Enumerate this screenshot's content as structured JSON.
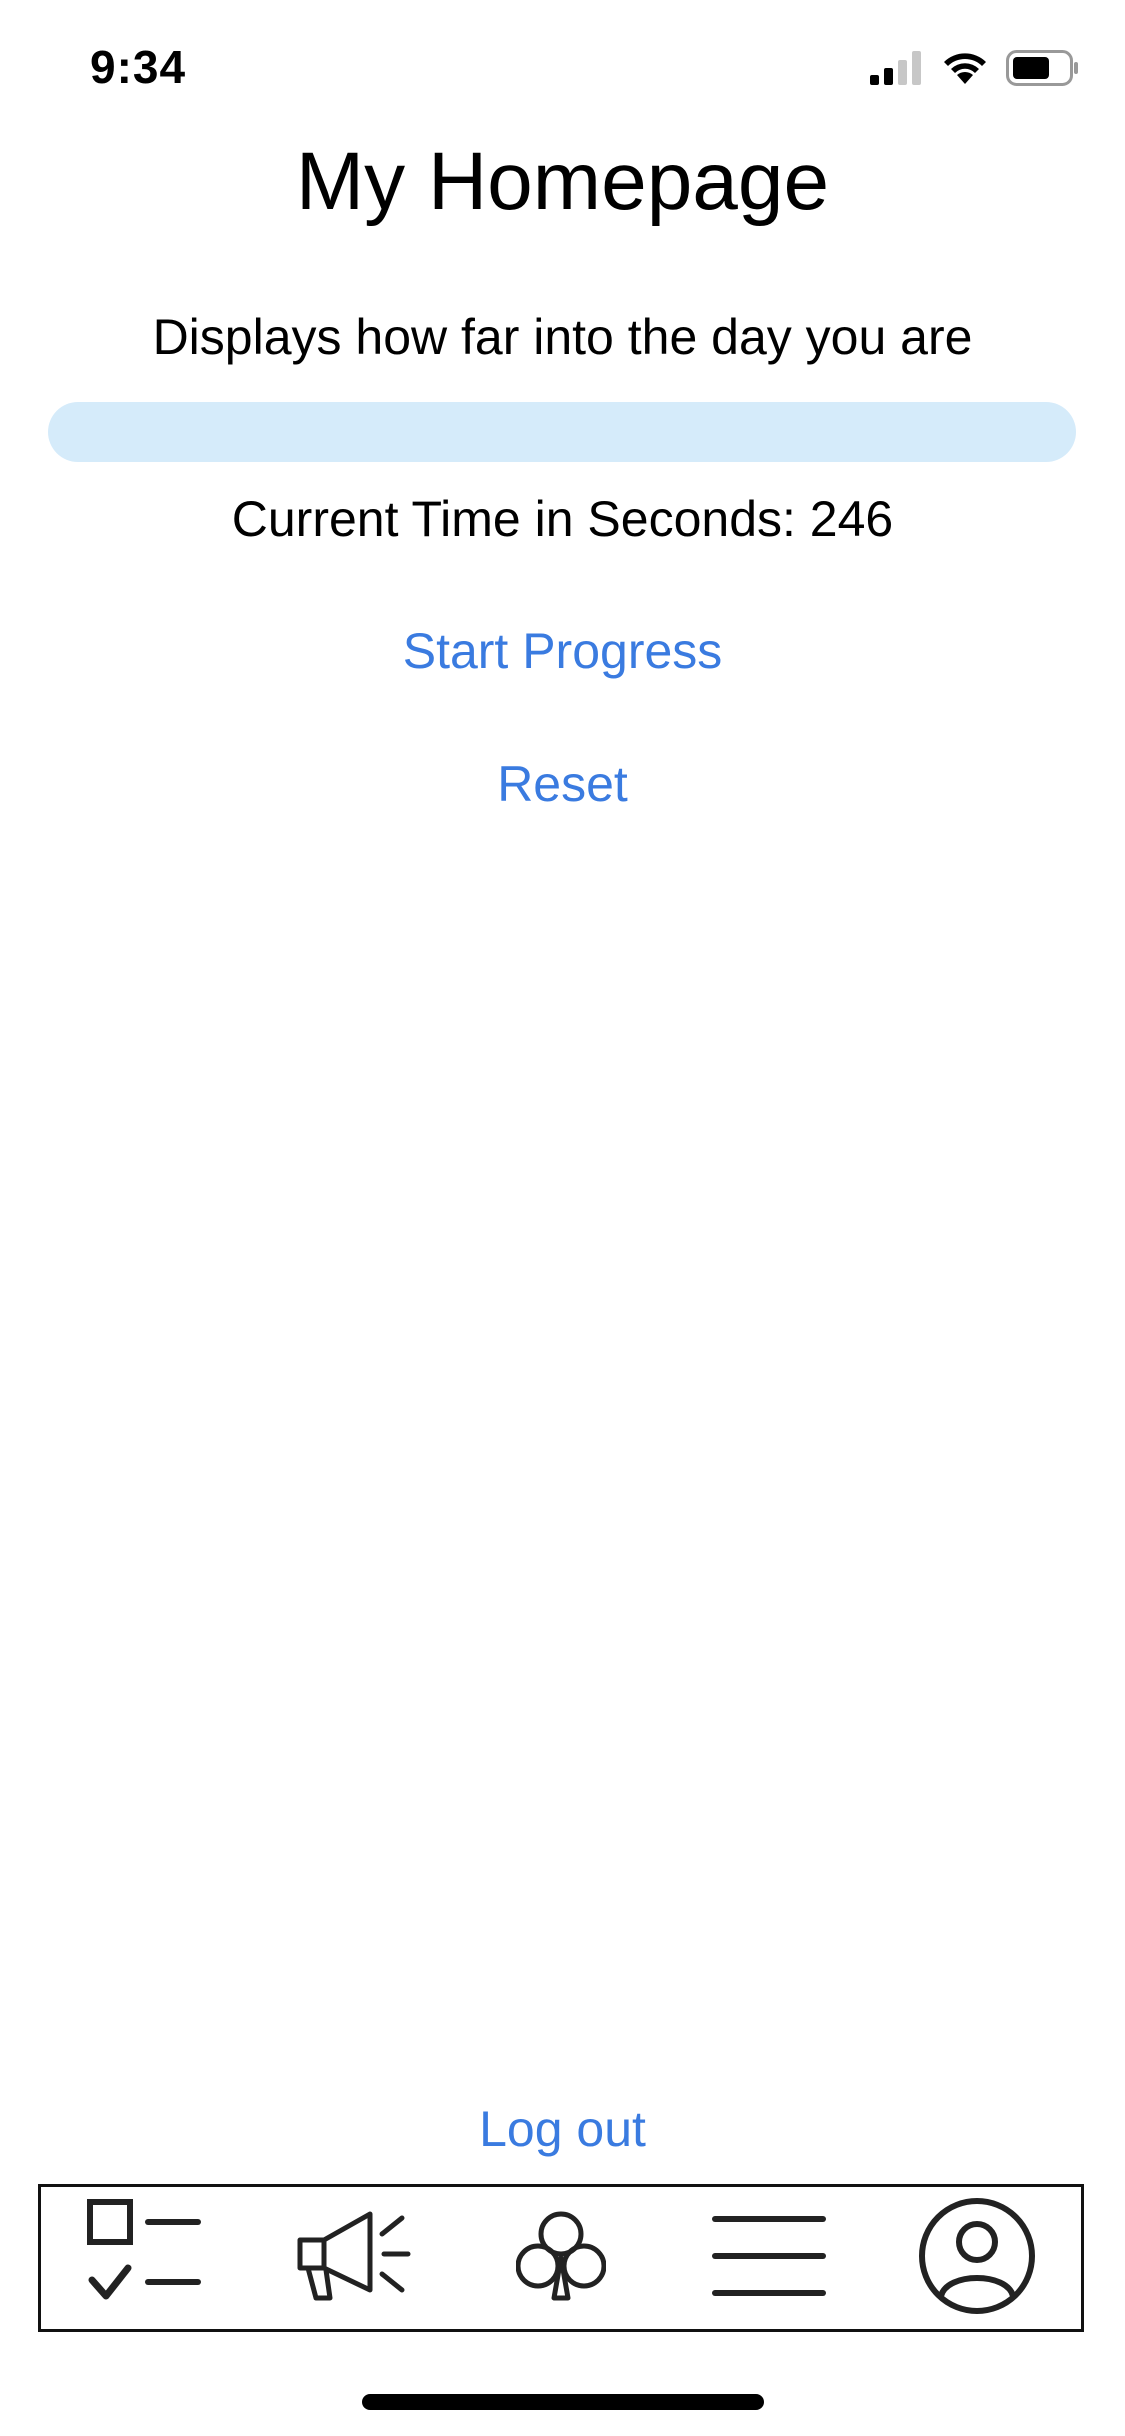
{
  "status_bar": {
    "time": "9:34",
    "icons": [
      "cellular-signal-icon",
      "wifi-icon",
      "battery-icon"
    ]
  },
  "header": {
    "title": "My Homepage"
  },
  "main": {
    "subtitle": "Displays how far into the day you are",
    "progress": {
      "value_percent": 0,
      "track_color": "#d5ebfa",
      "fill_color": "#3478f6"
    },
    "time_label": "Current Time in Seconds: 246",
    "start_button": "Start Progress",
    "reset_button": "Reset"
  },
  "footer": {
    "logout_button": "Log out"
  },
  "tab_bar": {
    "items": [
      {
        "icon": "checklist-icon"
      },
      {
        "icon": "megaphone-icon"
      },
      {
        "icon": "club-icon"
      },
      {
        "icon": "menu-icon"
      },
      {
        "icon": "profile-icon"
      }
    ]
  },
  "colors": {
    "accent": "#3a7be0",
    "background": "#ffffff",
    "text": "#000000"
  }
}
